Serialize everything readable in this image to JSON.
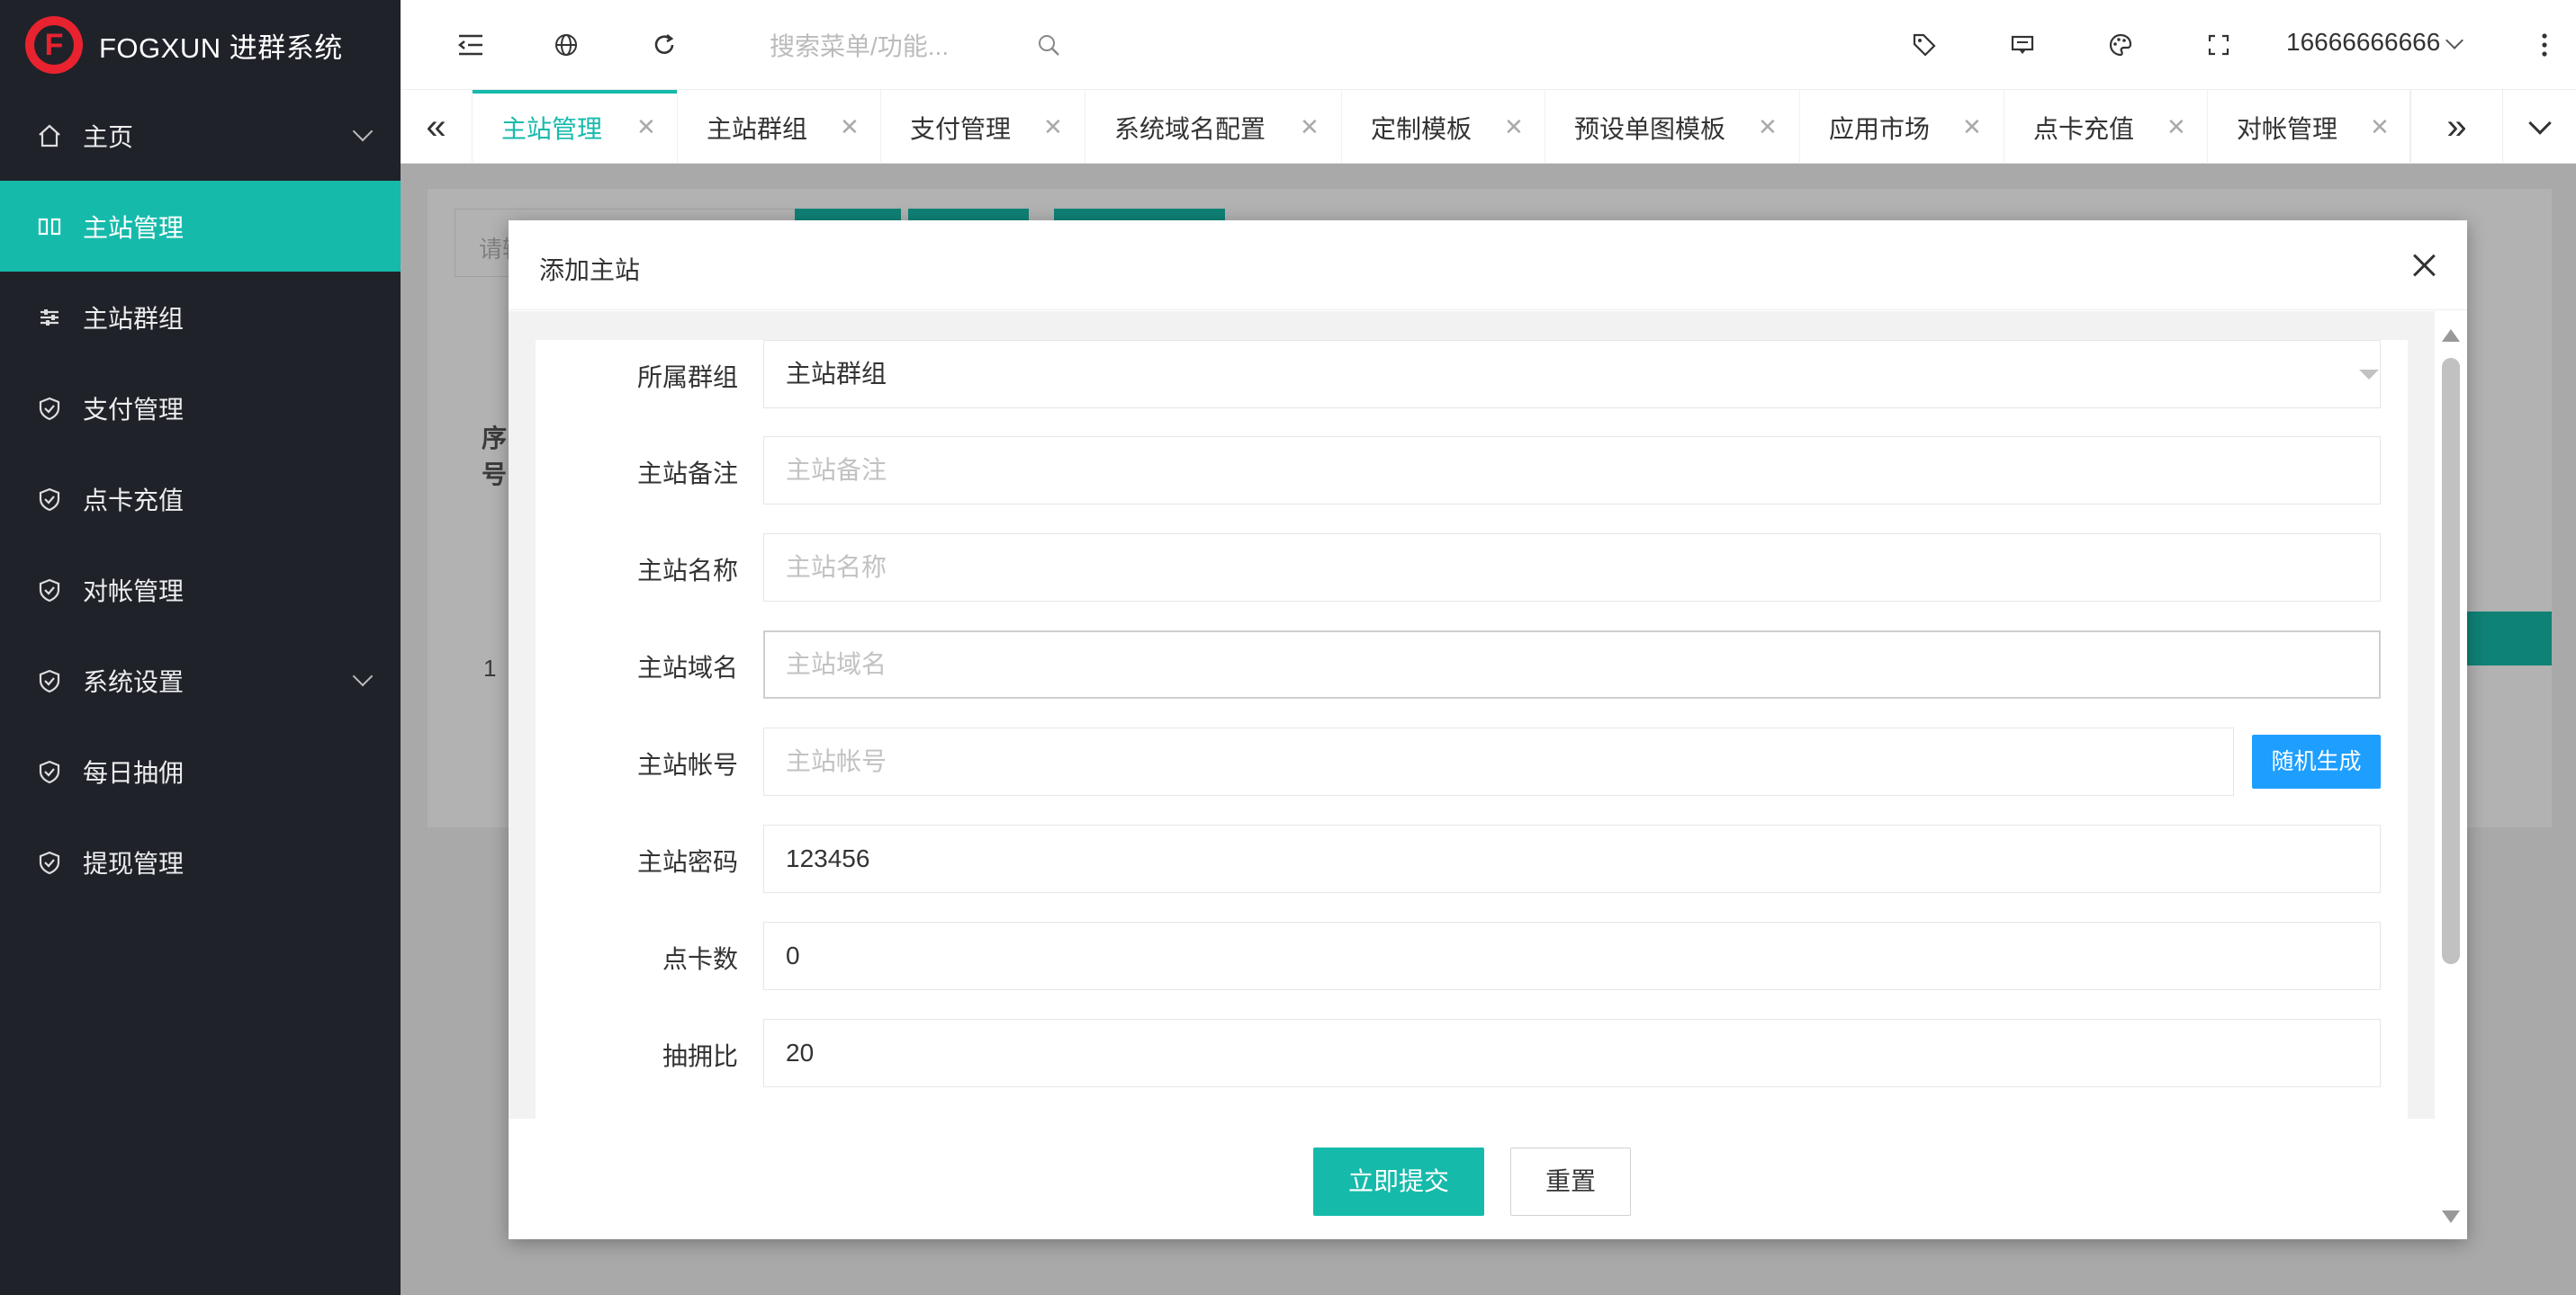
{
  "app": {
    "logo_letter": "F",
    "title": "FOGXUN 进群系统"
  },
  "sidebar": {
    "items": [
      {
        "label": "主页",
        "icon": "home-icon",
        "expandable": true
      },
      {
        "label": "主站管理",
        "icon": "columns-icon",
        "active": true
      },
      {
        "label": "主站群组",
        "icon": "sliders-icon"
      },
      {
        "label": "支付管理",
        "icon": "shield-check-icon"
      },
      {
        "label": "点卡充值",
        "icon": "shield-check-icon"
      },
      {
        "label": "对帐管理",
        "icon": "shield-check-icon"
      },
      {
        "label": "系统设置",
        "icon": "shield-check-icon",
        "expandable": true
      },
      {
        "label": "每日抽佣",
        "icon": "shield-check-icon"
      },
      {
        "label": "提现管理",
        "icon": "shield-check-icon"
      }
    ]
  },
  "header": {
    "search_placeholder": "搜索菜单/功能...",
    "user": "16666666666"
  },
  "tabs": [
    {
      "label": "主站管理",
      "active": true
    },
    {
      "label": "主站群组"
    },
    {
      "label": "支付管理"
    },
    {
      "label": "系统域名配置"
    },
    {
      "label": "定制模板"
    },
    {
      "label": "预设单图模板"
    },
    {
      "label": "应用市场"
    },
    {
      "label": "点卡充值"
    },
    {
      "label": "对帐管理"
    }
  ],
  "page": {
    "search_placeholder": "请输",
    "column_header": "序号",
    "row_index": "1"
  },
  "modal": {
    "title": "添加主站",
    "fields": [
      {
        "label": "所属群组",
        "value": "主站群组",
        "placeholder": ""
      },
      {
        "label": "主站备注",
        "value": "",
        "placeholder": "主站备注"
      },
      {
        "label": "主站名称",
        "value": "",
        "placeholder": "主站名称"
      },
      {
        "label": "主站域名",
        "value": "",
        "placeholder": "主站域名"
      },
      {
        "label": "主站帐号",
        "value": "",
        "placeholder": "主站帐号"
      },
      {
        "label": "主站密码",
        "value": "123456",
        "placeholder": ""
      },
      {
        "label": "点卡数",
        "value": "0",
        "placeholder": ""
      },
      {
        "label": "抽拥比",
        "value": "20",
        "placeholder": ""
      }
    ],
    "random_button": "随机生成",
    "submit_button": "立即提交",
    "reset_button": "重置"
  },
  "colors": {
    "accent": "#16baaa",
    "sidebar_bg": "#20222a",
    "blue_button": "#1e9fff",
    "brand_red": "#e8232f"
  }
}
